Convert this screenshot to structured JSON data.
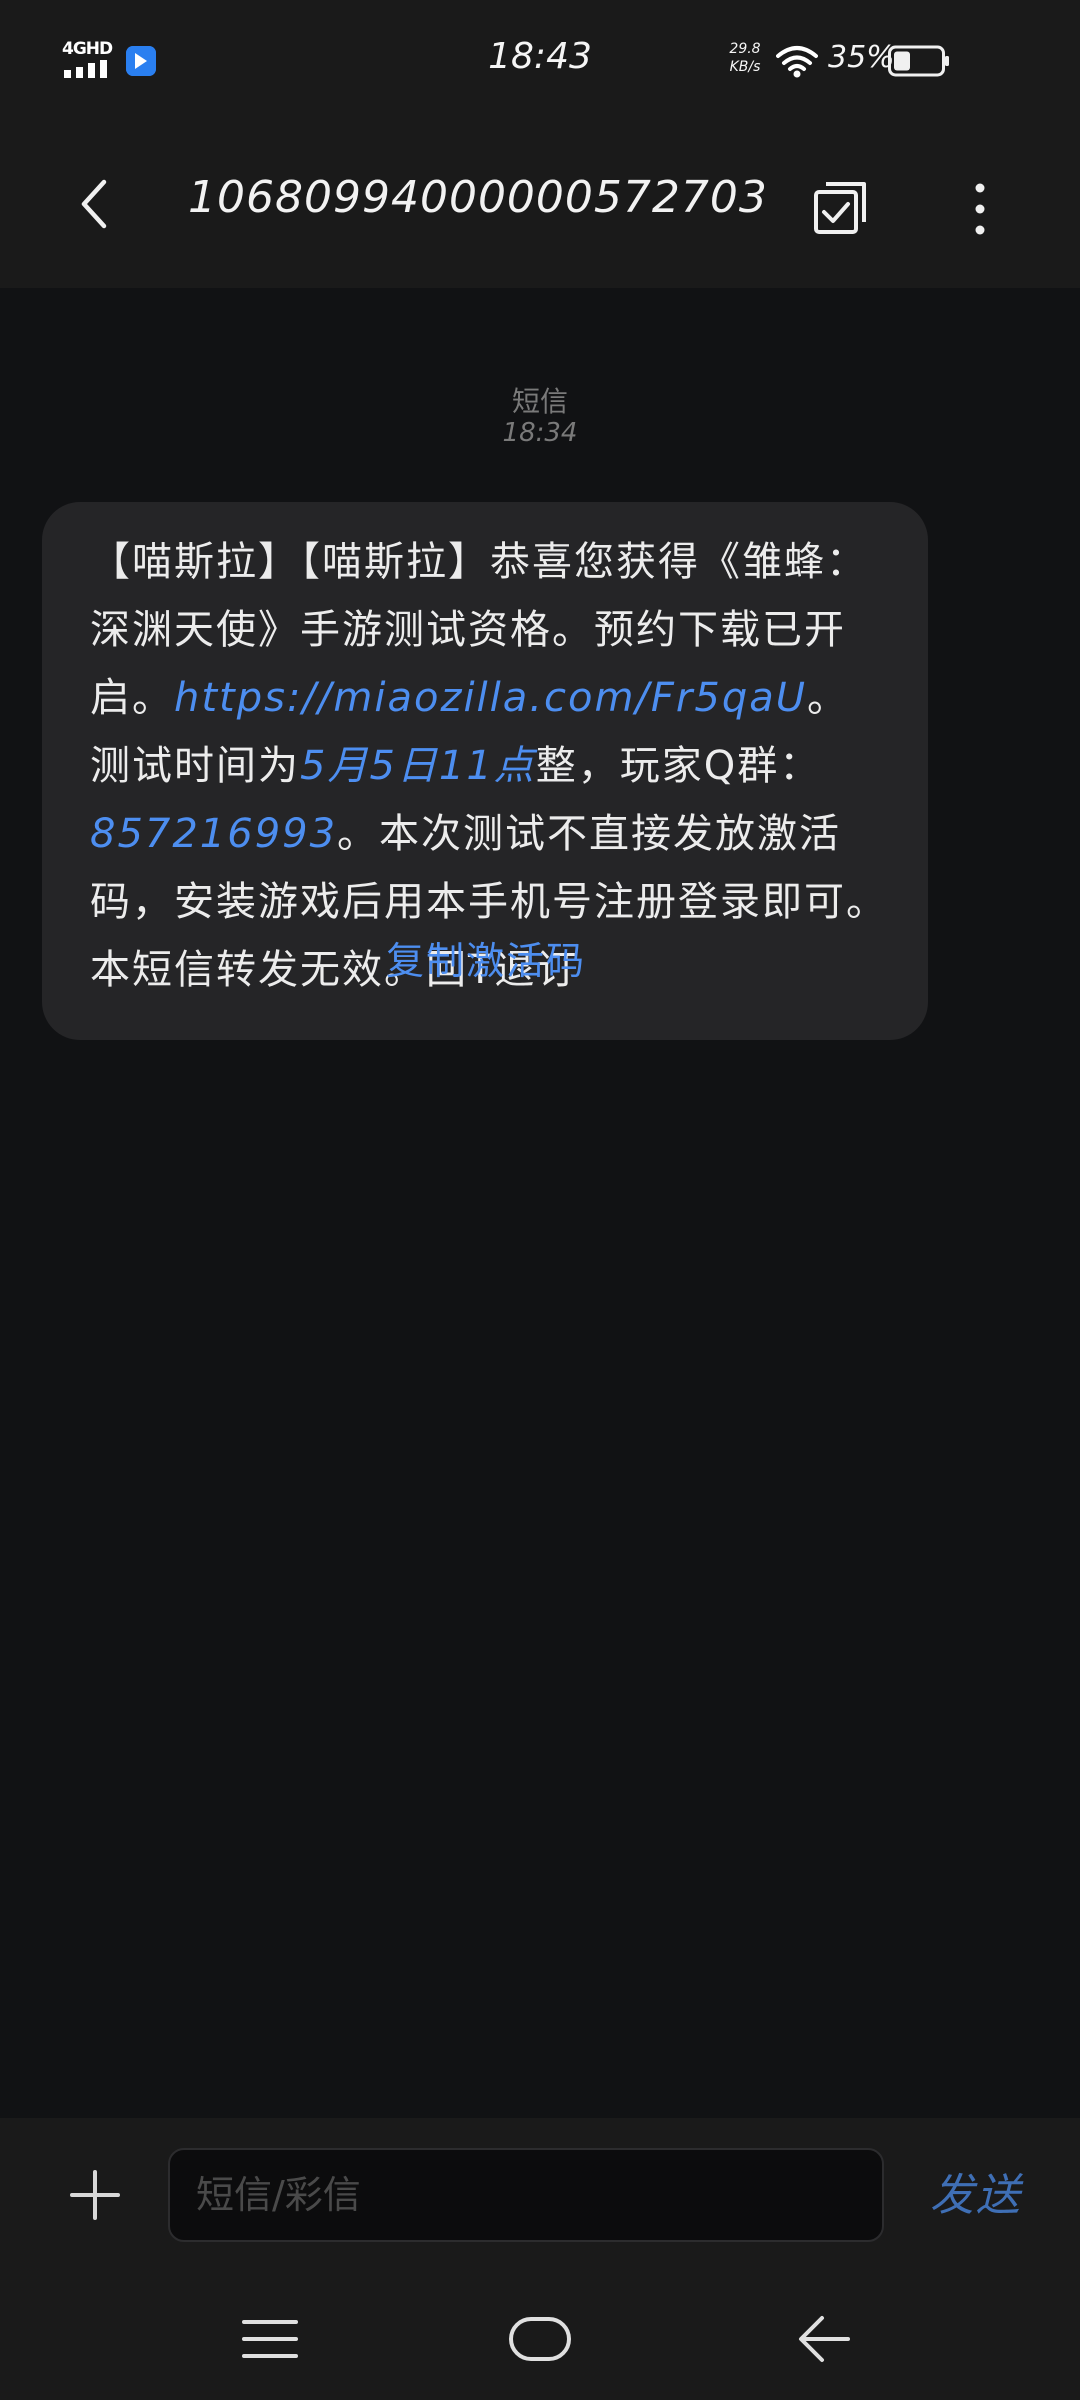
{
  "status_bar": {
    "network": "4GHD",
    "time": "18:43",
    "speed_value": "29.8",
    "speed_unit": "KB/s",
    "battery": "35%",
    "battery_level": 0.35
  },
  "header": {
    "title": "10680994000000572703"
  },
  "conversation": {
    "meta_type": "短信",
    "meta_time": "18:34",
    "message": {
      "p1": "【喵斯拉】【喵斯拉】恭喜您获得《雏蜂：深渊天使》手游测试资格。预约下载已开启。",
      "link1": "https://miaozilla.com/Fr5qaU",
      "p2": "。测试时间为",
      "link2": "5月5日11点",
      "p3": "整，玩家Q群：",
      "link3": "857216993",
      "p4": "。本次测试不直接发放激活码，安装游戏后用本手机号注册登录即可。本短信转发无效。回T退订"
    },
    "copy_label": "复制激活码"
  },
  "compose": {
    "placeholder": "短信/彩信",
    "send_label": "发送"
  },
  "colors": {
    "accent": "#4d8ef0",
    "send": "#3f6fb5",
    "bubble": "#252527",
    "background": "#111214",
    "bar": "#1a1a1a"
  },
  "icons": {
    "back": "chevron-left-icon",
    "select": "checkbox-select-icon",
    "more": "more-vertical-icon",
    "plus": "plus-icon",
    "nav_menu": "menu-icon",
    "nav_home": "home-icon",
    "nav_back": "back-arrow-icon"
  }
}
